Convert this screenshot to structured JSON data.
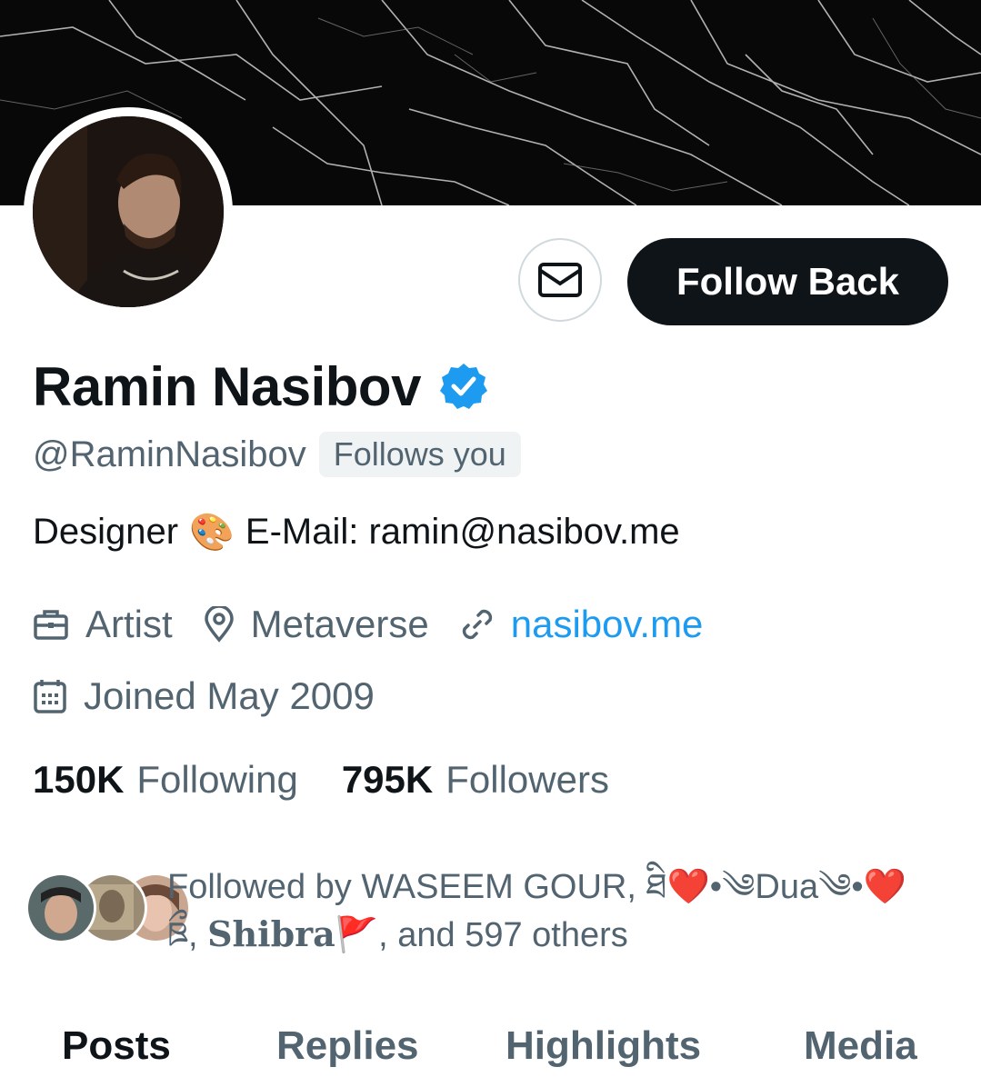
{
  "profile": {
    "name": "Ramin Nasibov",
    "handle": "@RaminNasibov",
    "follows_you": "Follows you",
    "bio_prefix": "Designer",
    "bio_emoji": "🎨",
    "bio_suffix": "E-Mail: ramin@nasibov.me",
    "occupation": "Artist",
    "location": "Metaverse",
    "website": "nasibov.me",
    "joined": "Joined May 2009",
    "verified": true
  },
  "actions": {
    "message_icon": "mail-icon",
    "follow_label": "Follow Back"
  },
  "stats": {
    "following_count": "150K",
    "following_label": "Following",
    "followers_count": "795K",
    "followers_label": "Followers"
  },
  "followed_by": {
    "prefix": "Followed by WASEEM GOUR,",
    "name2_a": "ཐི",
    "heart": "❤️",
    "name2_b": "•༄Dua༄•",
    "name2_c": "❤️",
    "name2_d": "ཋྀ",
    "sep": ",",
    "name3": "𝐒𝐡𝐢𝐛𝐫𝐚",
    "flag": "🚩",
    "suffix": ", and 597 others"
  },
  "tabs": [
    {
      "label": "Posts",
      "active": true
    },
    {
      "label": "Replies",
      "active": false
    },
    {
      "label": "Highlights",
      "active": false
    },
    {
      "label": "Media",
      "active": false
    }
  ],
  "colors": {
    "accent": "#1d9bf0",
    "text_primary": "#0f1419",
    "text_secondary": "#536471",
    "button_dark": "#0f1419"
  }
}
